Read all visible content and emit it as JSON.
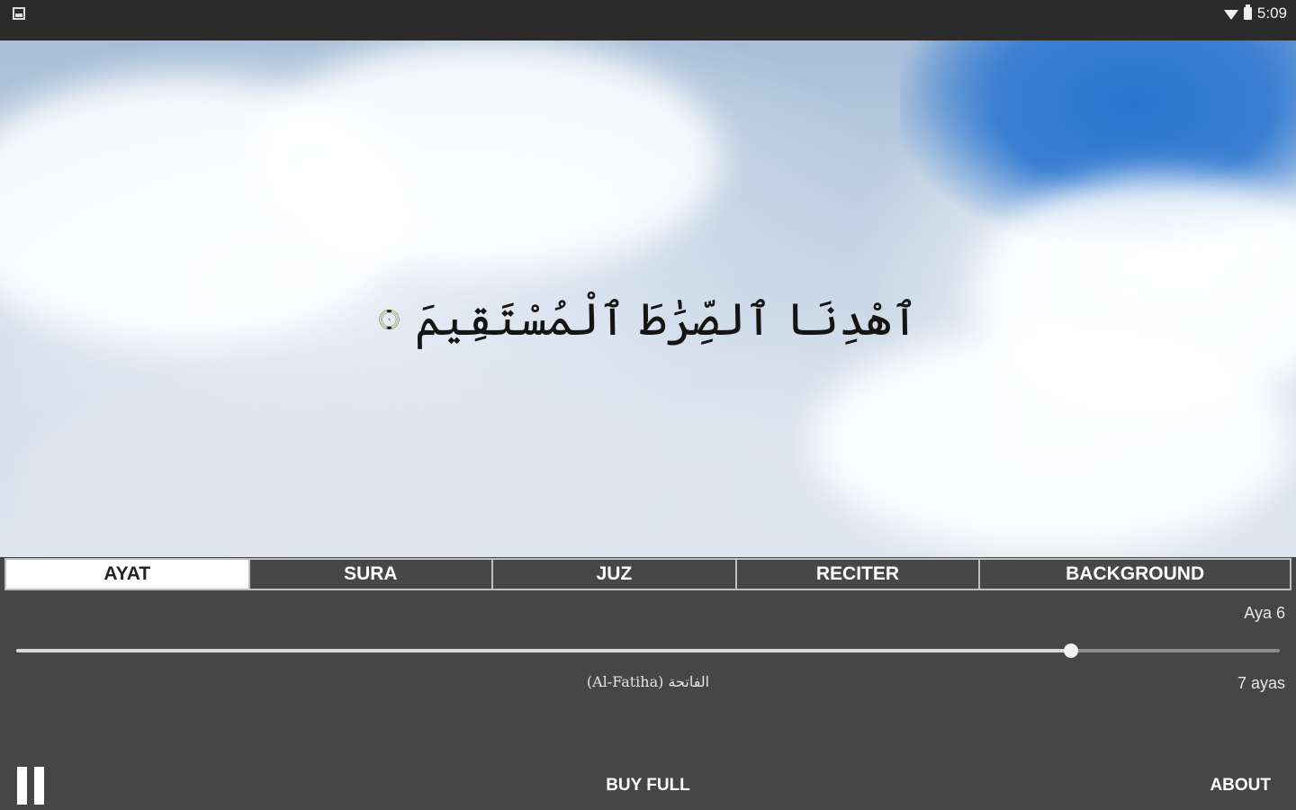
{
  "status_bar": {
    "time": "5:09",
    "icons": [
      "notification-icon",
      "wifi-icon",
      "battery-icon"
    ]
  },
  "scene": {
    "verse_text": "ٱهْدِنَا ٱلصِّرَٰطَ ٱلْمُسْتَقِيمَ",
    "ayah_number": "٦",
    "background": "sky-clouds"
  },
  "tabs": [
    {
      "label": "AYAT",
      "active": true
    },
    {
      "label": "SURA",
      "active": false
    },
    {
      "label": "JUZ",
      "active": false
    },
    {
      "label": "RECITER",
      "active": false
    },
    {
      "label": "BACKGROUND",
      "active": false
    }
  ],
  "player": {
    "aya_label": "Aya 6",
    "progress_fraction": 0.835,
    "sura_name": "(Al-Fatiha) الفاتحة",
    "ayas_count": "7 ayas"
  },
  "footer": {
    "buy_label": "BUY FULL",
    "about_label": "ABOUT"
  },
  "colors": {
    "panel": "#464646",
    "status_bar": "#2b2b2b",
    "active_tab": "#ffffff"
  }
}
